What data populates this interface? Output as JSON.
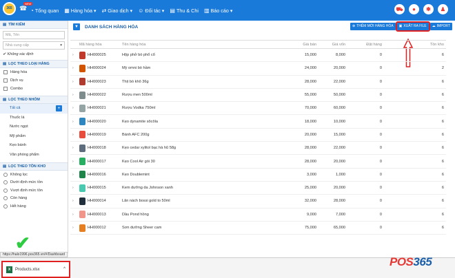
{
  "nav": {
    "logo": "365",
    "new_badge": "NEW",
    "items": [
      {
        "label": "Tổng quan",
        "icon": "dashboard-icon"
      },
      {
        "label": "Hàng hóa",
        "icon": "box-icon"
      },
      {
        "label": "Giao dịch",
        "icon": "exchange-icon"
      },
      {
        "label": "Đối tác",
        "icon": "partners-icon"
      },
      {
        "label": "Thu & Chi",
        "icon": "money-icon"
      },
      {
        "label": "Báo cáo",
        "icon": "report-icon"
      }
    ]
  },
  "sidebar": {
    "search_head": "TÌM KIẾM",
    "search_placeholder": "Mã, Tên",
    "supplier_placeholder": "Nhà cung cấp",
    "unspecified": "Không xác định",
    "type_head": "LỌC THEO LOẠI HÀNG",
    "types": [
      "Hàng hóa",
      "Dịch vụ",
      "Combo"
    ],
    "group_head": "LỌC THEO NHÓM",
    "groups": [
      "Tất cả",
      "Thuốc lá",
      "Nước ngọt",
      "Mỹ phẩm",
      "Kẹo bánh",
      "Văn phòng phẩm"
    ],
    "stock_head": "LỌC THEO TỒN KHO",
    "stock": [
      "Không lọc",
      "Dưới định mức tồn",
      "Vượt định mức tồn",
      "Còn hàng",
      "Hết hàng"
    ]
  },
  "status": {
    "url": "https://halo1996.pos365.vn/#/Dashboard",
    "download_file": "Products.xlsx"
  },
  "main": {
    "title": "DANH SÁCH HÀNG HÓA",
    "btn_add": "THÊM MỚI HÀNG HÓA",
    "btn_export": "XUẤT RA FILE",
    "btn_import": "IMPORT",
    "columns": [
      "Mã hàng hóa",
      "Tên hàng hóa",
      "Giá bán",
      "Giá vốn",
      "Đặt hàng",
      "Tồn kho"
    ],
    "rows": [
      {
        "code": "HH000025",
        "name": "Hộp phở bò phổ cổ",
        "price": "15,000",
        "cost": "8,000",
        "ordered": "0",
        "stock": "6",
        "color": "#c0392b"
      },
      {
        "code": "HH000024",
        "name": "Mỳ omni bò hầm",
        "price": "24,000",
        "cost": "20,000",
        "ordered": "0",
        "stock": "2",
        "color": "#d35400"
      },
      {
        "code": "HH000023",
        "name": "Thịt bò khô 36g",
        "price": "28,000",
        "cost": "22,000",
        "ordered": "0",
        "stock": "6",
        "color": "#b03a2e"
      },
      {
        "code": "HH000022",
        "name": "Rượu men 500ml",
        "price": "55,000",
        "cost": "50,000",
        "ordered": "0",
        "stock": "6",
        "color": "#7f8c8d"
      },
      {
        "code": "HH000021",
        "name": "Rượu Vodka 750ml",
        "price": "70,000",
        "cost": "60,000",
        "ordered": "0",
        "stock": "6",
        "color": "#95a5a6"
      },
      {
        "code": "HH000020",
        "name": "Kẹo dynamite sôcôla",
        "price": "18,000",
        "cost": "10,000",
        "ordered": "0",
        "stock": "6",
        "color": "#2e86c1"
      },
      {
        "code": "HH000019",
        "name": "Bánh AFC 200g",
        "price": "20,000",
        "cost": "15,000",
        "ordered": "0",
        "stock": "6",
        "color": "#e74c3c"
      },
      {
        "code": "HH000018",
        "name": "Kẹo cedar xylitol bạc hà hũ 58g",
        "price": "28,000",
        "cost": "22,000",
        "ordered": "0",
        "stock": "6",
        "color": "#5d6d7e"
      },
      {
        "code": "HH000017",
        "name": "Kẹo Cool Air gói 30",
        "price": "28,000",
        "cost": "20,000",
        "ordered": "0",
        "stock": "6",
        "color": "#27ae60"
      },
      {
        "code": "HH000016",
        "name": "Kẹo Doublemint",
        "price": "3,000",
        "cost": "1,000",
        "ordered": "0",
        "stock": "6",
        "color": "#1e8449"
      },
      {
        "code": "HH000015",
        "name": "Kem dưỡng da Johnson xanh",
        "price": "25,000",
        "cost": "20,000",
        "ordered": "0",
        "stock": "6",
        "color": "#48c9b0"
      },
      {
        "code": "HH000014",
        "name": "Lăn nách bossi gold to 50ml",
        "price": "32,000",
        "cost": "28,000",
        "ordered": "0",
        "stock": "6",
        "color": "#212f3d"
      },
      {
        "code": "HH000013",
        "name": "Dầu Pond hồng",
        "price": "9,000",
        "cost": "7,000",
        "ordered": "0",
        "stock": "6",
        "color": "#f1948a"
      },
      {
        "code": "HH000012",
        "name": "Sơn dưỡng Sheer cam",
        "price": "75,000",
        "cost": "65,000",
        "ordered": "0",
        "stock": "6",
        "color": "#e67e22"
      }
    ]
  },
  "watermark": {
    "part1": "POS",
    "part2": "365"
  }
}
